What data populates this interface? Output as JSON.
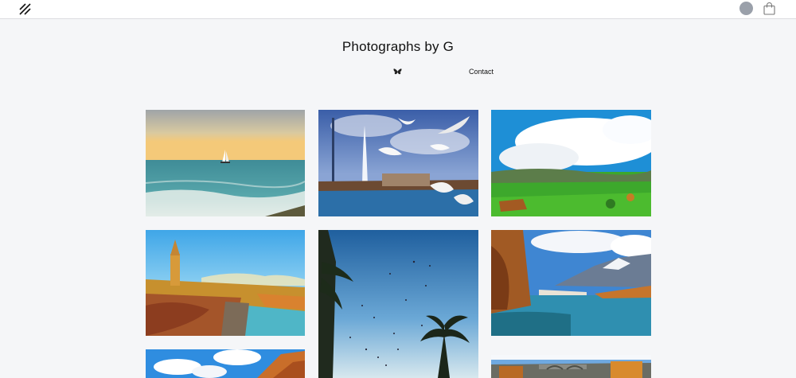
{
  "header": {
    "logo_icon": "double-slash-logo-icon",
    "avatar_icon": "user-avatar",
    "cart_icon": "shopping-bag-icon"
  },
  "site": {
    "title": "Photographs by G"
  },
  "nav": {
    "social_icon": "butterfly-icon",
    "contact_label": "Contact"
  },
  "gallery": {
    "photos": [
      {
        "subject": "sea-sailboat"
      },
      {
        "subject": "seagulls-jet-fountain"
      },
      {
        "subject": "green-landscape-clouds"
      },
      {
        "subject": "city-cathedral-autumn"
      },
      {
        "subject": "birds-palm-sky"
      },
      {
        "subject": "river-mountains-autumn"
      },
      {
        "subject": "sky-clouds-autumn-hill"
      },
      {
        "subject": "bridge-town-river"
      }
    ]
  }
}
